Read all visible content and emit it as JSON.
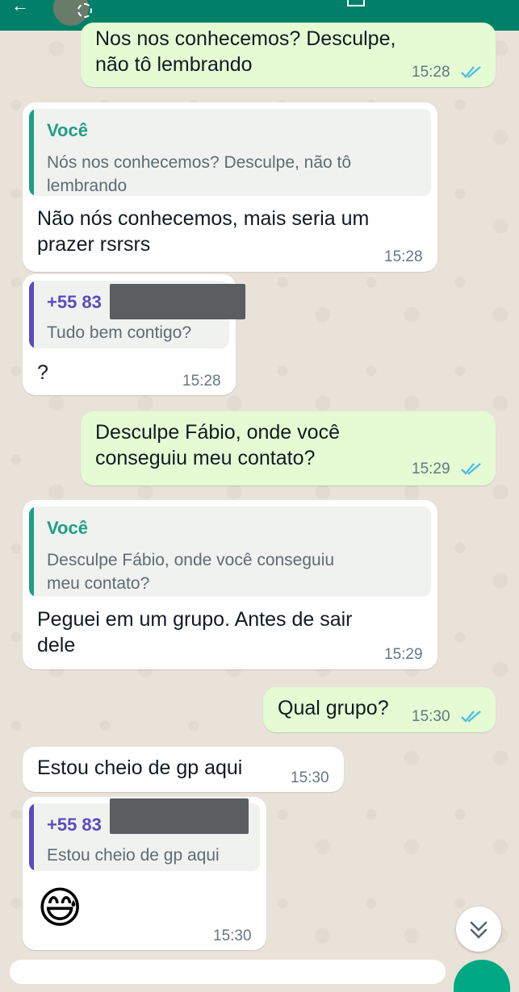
{
  "colors": {
    "header": "#008069",
    "chat_bg": "#e9e2d8",
    "outgoing_bubble": "#e4fbd4",
    "incoming_bubble": "#ffffff",
    "you_author": "#1f9e86",
    "contact_author": "#5b4bbf",
    "read_ticks": "#53bdeb"
  },
  "header": {
    "avatar_icon": "contact-avatar",
    "status_icon": "status-ring-icon"
  },
  "messages": [
    {
      "text": "Nos nos conhecemos? Desculpe,\nnão tô lembrando",
      "time": "15:28"
    },
    {
      "quote_author": "Você",
      "quote_text": "Nós nos conhecemos? Desculpe, não tô\nlembrando",
      "text": "Não nós conhecemos, mais seria um\nprazer rsrsrs",
      "time": "15:28"
    },
    {
      "quote_author": "+55 83",
      "quote_text": "Tudo bem contigo?",
      "text": "?",
      "time": "15:28"
    },
    {
      "text": "Desculpe Fábio, onde você\nconseguiu meu contato?",
      "time": "15:29"
    },
    {
      "quote_author": "Você",
      "quote_text": "Desculpe Fábio, onde você conseguiu\nmeu contato?",
      "text": "Peguei em um grupo.  Antes de sair\ndele",
      "time": "15:29"
    },
    {
      "text": "Qual grupo?",
      "time": "15:30"
    },
    {
      "text": "Estou cheio de gp aqui",
      "time": "15:30"
    },
    {
      "quote_author": "+55 83",
      "quote_text": "Estou cheio de gp aqui",
      "emoji": "😅",
      "time": "15:30"
    }
  ],
  "scroll_button_icon": "chevron-double-down-icon"
}
